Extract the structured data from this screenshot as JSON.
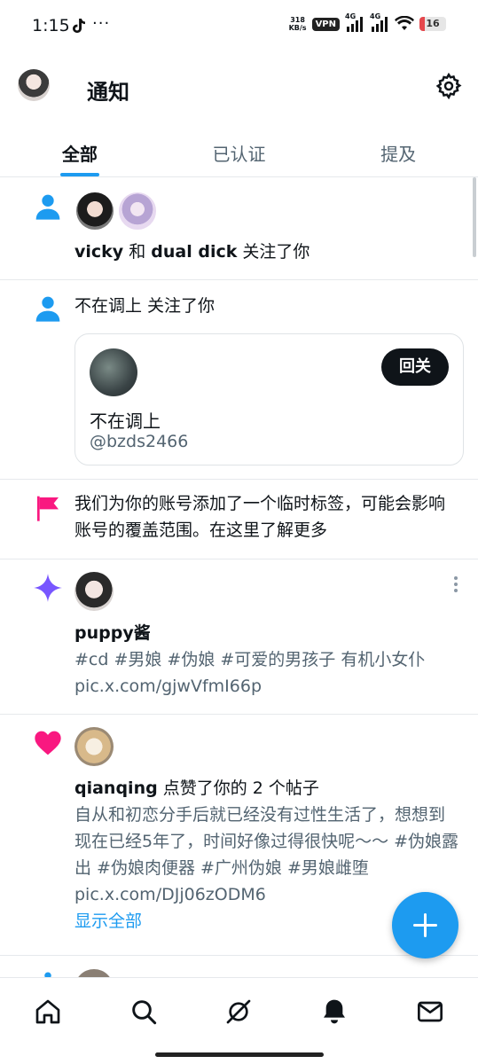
{
  "status_bar": {
    "time": "1:15",
    "dots": "···",
    "net_speed_value": "318",
    "net_speed_unit": "KB/s",
    "vpn": "VPN",
    "sim1": "4G",
    "sim2": "4G",
    "battery": "16"
  },
  "header": {
    "title": "通知"
  },
  "tabs": [
    {
      "label": "全部"
    },
    {
      "label": "已认证"
    },
    {
      "label": "提及"
    }
  ],
  "notifications": {
    "follow_group": {
      "name1": "vicky",
      "and": " 和 ",
      "name2": "dual dick",
      "action": " 关注了你"
    },
    "follow_single": {
      "name": "不在调上",
      "action": " 关注了你",
      "card_name": "不在调上",
      "card_handle": "@bzds2466",
      "button": "回关"
    },
    "label_notice": {
      "text": "我们为你的账号添加了一个临时标签，可能会影响账号的覆盖范围。在这里了解更多"
    },
    "post": {
      "author": "puppy酱",
      "text": "#cd #男娘 #伪娘 #可爱的男孩子 有机小女仆",
      "link": "pic.x.com/gjwVfmI66p"
    },
    "like": {
      "name": "qianqing",
      "action": " 点赞了你的 2 个帖子",
      "text": "自从和初恋分手后就已经没有过性生活了，想想到现在已经5年了，时间好像过得很快呢～～ #伪娘露出 #伪娘肉便器 #广州伪娘 #男娘雌堕 pic.x.com/DJj06zODM6",
      "show_all": "显示全部"
    }
  },
  "colors": {
    "accent": "#1d9bf0",
    "like": "#f91880",
    "flag": "#f91880",
    "spark": "#7856ff"
  }
}
